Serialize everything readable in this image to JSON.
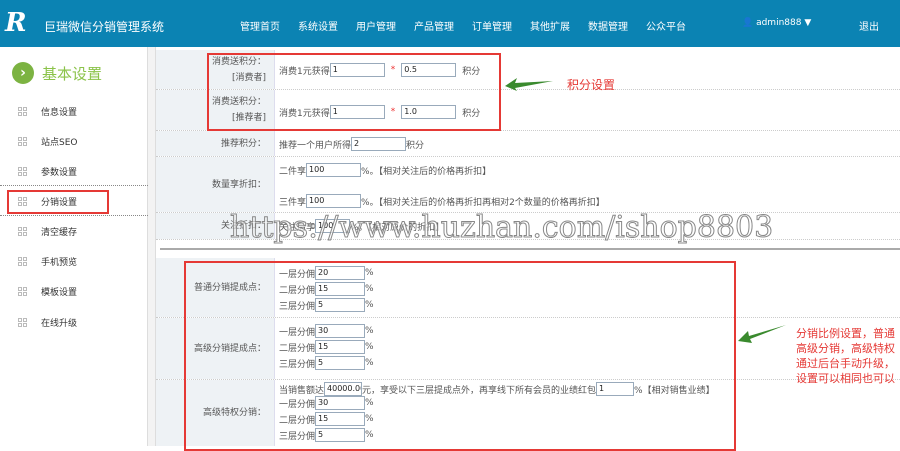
{
  "header": {
    "logo": "R",
    "brand": "巨瑞微信分销管理系统",
    "nav": [
      "管理首页",
      "系统设置",
      "用户管理",
      "产品管理",
      "订单管理",
      "其他扩展",
      "数据管理",
      "公众平台"
    ],
    "user": "admin888",
    "logout": "退出"
  },
  "sidebar": {
    "section": "基本设置",
    "items": [
      "信息设置",
      "站点SEO",
      "参数设置",
      "分销设置",
      "清空缓存",
      "手机预览",
      "模板设置",
      "在线升级"
    ]
  },
  "points": {
    "consumer": {
      "label1": "消费送积分：",
      "label2": "[消费者]",
      "prefix": "消费1元获得",
      "a": "1",
      "b": "0.5",
      "unit": "积分"
    },
    "referrer": {
      "label1": "消费送积分：",
      "label2": "[推荐者]",
      "prefix": "消费1元获得",
      "a": "1",
      "b": "1.0",
      "unit": "积分"
    },
    "recommend": {
      "label": "推荐积分：",
      "prefix": "推荐一个用户所得",
      "value": "2",
      "unit": "积分"
    },
    "qty": {
      "label": "数量享折扣：",
      "two_prefix": "二件享",
      "two": "100",
      "two_note": "%。【相对关注后的价格再折扣】",
      "three_prefix": "三件享",
      "three": "100",
      "three_note": "%。【相对关注后的价格再折扣再相对2个数量的价格再折扣】"
    },
    "follow": {
      "label": "关注折扣：",
      "prefix": "关注后享",
      "value": "100",
      "note": "%。【相对原价的折扣】"
    }
  },
  "distribution": {
    "normal": {
      "label": "普通分销提成点：",
      "levels": [
        {
          "name": "一层分佣",
          "value": "20"
        },
        {
          "name": "二层分佣",
          "value": "15"
        },
        {
          "name": "三层分佣",
          "value": "5"
        }
      ]
    },
    "advanced": {
      "label": "高级分销提成点：",
      "levels": [
        {
          "name": "一层分佣",
          "value": "30"
        },
        {
          "name": "二层分佣",
          "value": "15"
        },
        {
          "name": "三层分佣",
          "value": "5"
        }
      ]
    },
    "privilege": {
      "label": "高级特权分销：",
      "prefix": "当销售额达",
      "amount": "40000.00",
      "mid": "元，享受以下三层提成点外，再享线下所有会员的业绩红包",
      "bonus": "1",
      "note": "%【相对销售业绩】",
      "levels": [
        {
          "name": "一层分佣",
          "value": "30"
        },
        {
          "name": "二层分佣",
          "value": "15"
        },
        {
          "name": "三层分佣",
          "value": "5"
        }
      ]
    }
  },
  "pct": "%",
  "annotations": {
    "points": "积分设置",
    "dist": [
      "分销比例设置，普通",
      "高级分销，高级特权",
      "通过后台手动升级，",
      "设置可以相同也可以"
    ]
  },
  "watermark": "https://www.huzhan.com/ishop8803"
}
